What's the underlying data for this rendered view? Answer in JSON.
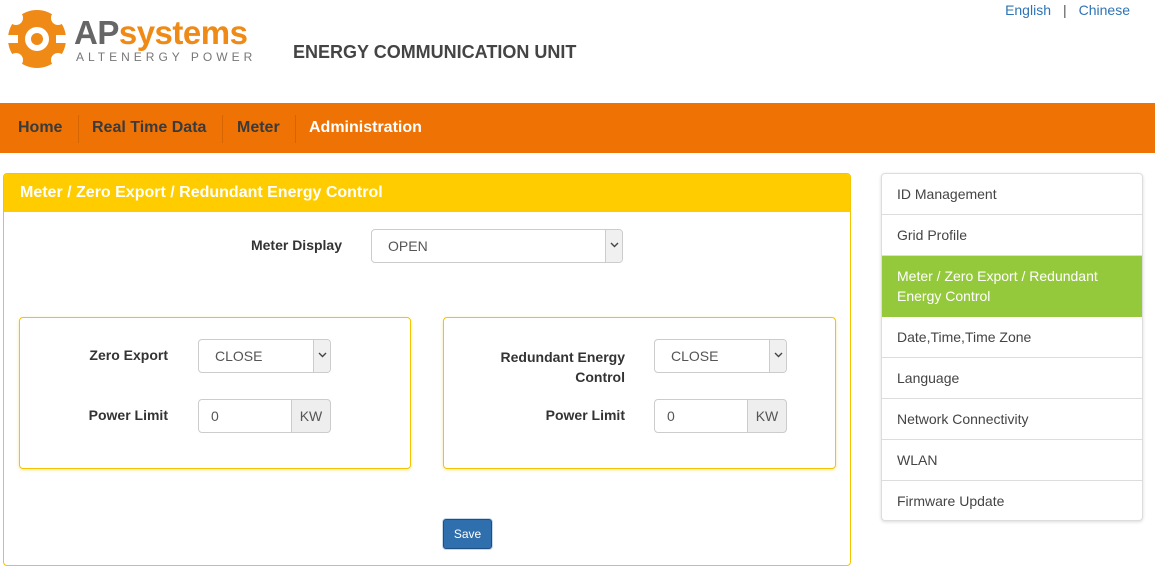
{
  "header": {
    "brand_ap": "AP",
    "brand_systems": "systems",
    "brand_tagline": "ALTENERGY POWER",
    "title": "ENERGY COMMUNICATION UNIT",
    "lang_english": "English",
    "lang_separator": "|",
    "lang_chinese": "Chinese"
  },
  "nav": {
    "items": [
      {
        "label": "Home"
      },
      {
        "label": "Real Time Data"
      },
      {
        "label": "Meter"
      },
      {
        "label": "Administration"
      }
    ]
  },
  "panel": {
    "title": "Meter / Zero Export / Redundant Energy Control",
    "meter_display_label": "Meter Display",
    "meter_display_value": "OPEN",
    "zero_export": {
      "label": "Zero Export",
      "value": "CLOSE",
      "power_limit_label": "Power Limit",
      "power_limit_value": "0",
      "unit": "KW"
    },
    "redundant": {
      "label_line1": "Redundant Energy",
      "label_line2": "Control",
      "value": "CLOSE",
      "power_limit_label": "Power Limit",
      "power_limit_value": "0",
      "unit": "KW"
    },
    "save_label": "Save"
  },
  "sidebar": {
    "items": [
      {
        "label": "ID Management"
      },
      {
        "label": "Grid Profile"
      },
      {
        "label_line1": "Meter / Zero Export / Redundant",
        "label_line2": "Energy Control"
      },
      {
        "label": "Date,Time,Time Zone"
      },
      {
        "label": "Language"
      },
      {
        "label": "Network Connectivity"
      },
      {
        "label": "WLAN"
      },
      {
        "label": "Firmware Update"
      }
    ]
  },
  "colors": {
    "nav_bg": "#ee7304",
    "panel_header": "#ffcc00",
    "sidebar_active": "#95c93c",
    "save_button": "#2f6fae",
    "link": "#2e74b5"
  }
}
